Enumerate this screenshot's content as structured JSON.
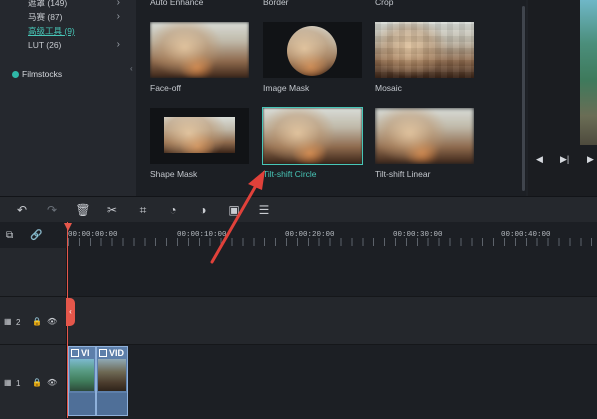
{
  "sidebar": {
    "items": [
      {
        "label": "遮罩 (149)"
      },
      {
        "label": "马赛 (87)"
      },
      {
        "label": "高级工具 (9)",
        "active": true
      },
      {
        "label": "LUT (26)"
      }
    ],
    "filmstocks_label": "Filmstocks"
  },
  "effects": {
    "top_labels": [
      "Auto Enhance",
      "Border",
      "Crop"
    ],
    "row1": [
      "Face-off",
      "Image Mask",
      "Mosaic"
    ],
    "row2": [
      "Shape Mask",
      "Tilt-shift Circle",
      "Tilt-shift Linear"
    ],
    "selected": "Tilt-shift Circle"
  },
  "preview": {
    "controls": [
      "◀",
      "▶|",
      "▶"
    ]
  },
  "toolbar": {
    "icons": [
      "undo-icon",
      "redo-icon",
      "delete-icon",
      "cut-icon",
      "crop-icon",
      "speed-icon",
      "color-icon",
      "green-screen-icon",
      "audio-mixer-icon"
    ]
  },
  "timeline": {
    "timecodes": [
      "00:00:00:00",
      "00:00:10:00",
      "00:00:20:00",
      "00:00:30:00",
      "00:00:40:00"
    ],
    "tracks": [
      {
        "number": "2"
      },
      {
        "number": "1"
      }
    ],
    "clips": [
      {
        "label": "VI"
      },
      {
        "label": "VID"
      }
    ]
  },
  "colors": {
    "accent": "#47c6b7",
    "playhead": "#e5574b",
    "annotation_arrow": "#e0413a",
    "clip": "#5d7faa"
  }
}
